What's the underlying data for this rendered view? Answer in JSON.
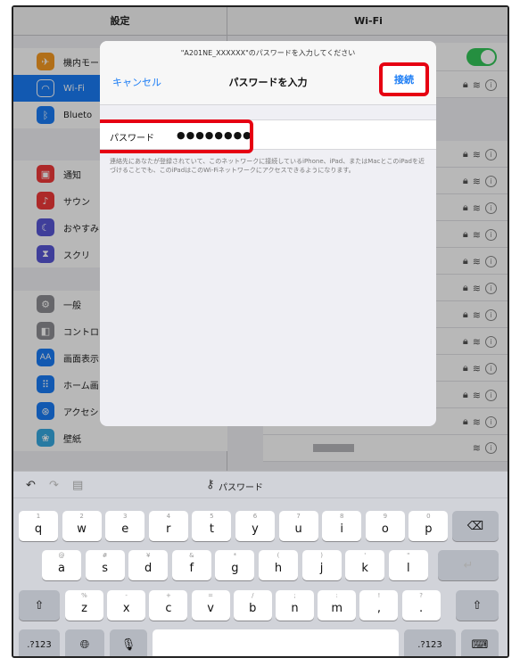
{
  "settings": {
    "title": "設定",
    "items": [
      {
        "label": "機内モー",
        "icon": "airplane-icon",
        "color": "#f59a23"
      },
      {
        "label": "Wi-Fi",
        "icon": "wifi-icon",
        "color": "#1a7cf5"
      },
      {
        "label": "Blueto",
        "icon": "bluetooth-icon",
        "color": "#1a7cf5"
      },
      {
        "label": "通知",
        "icon": "notification-icon",
        "color": "#f0393a"
      },
      {
        "label": "サウン",
        "icon": "sound-icon",
        "color": "#f0393a"
      },
      {
        "label": "おやすみ",
        "icon": "moon-icon",
        "color": "#5856d6"
      },
      {
        "label": "スクリ",
        "icon": "hourglass-icon",
        "color": "#5856d6"
      },
      {
        "label": "一般",
        "icon": "gear-icon",
        "color": "#8e8e93"
      },
      {
        "label": "コントロ",
        "icon": "toggle-switch-icon",
        "color": "#8e8e93"
      },
      {
        "label": "画面表示",
        "icon": "text-size-icon",
        "color": "#1a7cf5"
      },
      {
        "label": "ホーム画",
        "icon": "grid-icon",
        "color": "#1a7cf5"
      },
      {
        "label": "アクセシ",
        "icon": "accessibility-icon",
        "color": "#1a7cf5"
      },
      {
        "label": "壁紙",
        "icon": "flower-icon",
        "color": "#36a9e1"
      }
    ]
  },
  "wifi": {
    "title": "Wi-Fi"
  },
  "modal": {
    "prompt": "\"A201NE_XXXXXX\"のパスワードを入力してください",
    "cancel": "キャンセル",
    "title": "パスワードを入力",
    "connect": "接続",
    "password_label": "パスワード",
    "password_value": "●●●●●●●●",
    "note": "連絡先にあなたが登録されていて、このネットワークに接続しているiPhone、iPad、またはMacとこのiPadを近づけることでも、このiPadはこのWi-Fiネットワークにアクセスできるようになります。",
    "highlight_color": "#e60012"
  },
  "keyboard": {
    "bar_label": "パスワード",
    "row1": [
      {
        "main": "q",
        "sub": "1"
      },
      {
        "main": "w",
        "sub": "2"
      },
      {
        "main": "e",
        "sub": "3"
      },
      {
        "main": "r",
        "sub": "4"
      },
      {
        "main": "t",
        "sub": "5"
      },
      {
        "main": "y",
        "sub": "6"
      },
      {
        "main": "u",
        "sub": "7"
      },
      {
        "main": "i",
        "sub": "8"
      },
      {
        "main": "o",
        "sub": "9"
      },
      {
        "main": "p",
        "sub": "0"
      }
    ],
    "row2": [
      {
        "main": "a",
        "sub": "@"
      },
      {
        "main": "s",
        "sub": "#"
      },
      {
        "main": "d",
        "sub": "¥"
      },
      {
        "main": "f",
        "sub": "&"
      },
      {
        "main": "g",
        "sub": "*"
      },
      {
        "main": "h",
        "sub": "("
      },
      {
        "main": "j",
        "sub": ")"
      },
      {
        "main": "k",
        "sub": "'"
      },
      {
        "main": "l",
        "sub": "\""
      }
    ],
    "row3": [
      {
        "main": "z",
        "sub": "%"
      },
      {
        "main": "x",
        "sub": "-"
      },
      {
        "main": "c",
        "sub": "+"
      },
      {
        "main": "v",
        "sub": "="
      },
      {
        "main": "b",
        "sub": "/"
      },
      {
        "main": "n",
        "sub": ";"
      },
      {
        "main": "m",
        "sub": ":"
      },
      {
        "main": ",",
        "sub": "!"
      },
      {
        "main": ".",
        "sub": "?"
      }
    ],
    "numbers_label": ".?123"
  }
}
